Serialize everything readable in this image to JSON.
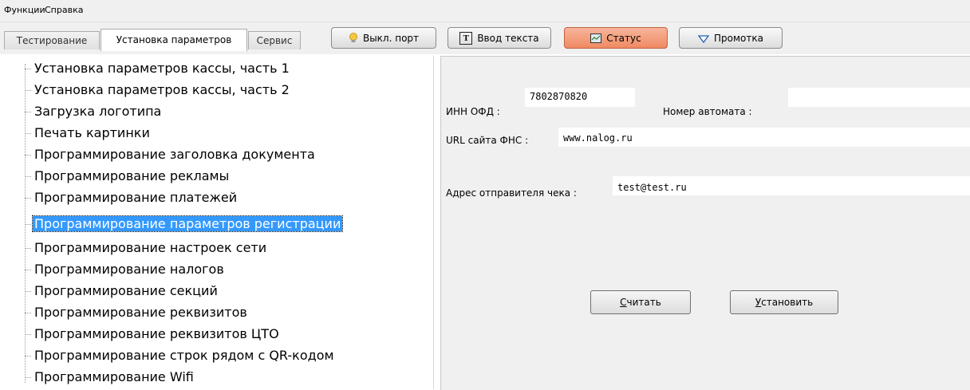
{
  "menubar": {
    "functions": "Функции",
    "help": "Справка"
  },
  "tabs": [
    {
      "label": "Тестирование",
      "active": false
    },
    {
      "label": "Установка параметров",
      "active": true
    },
    {
      "label": "Сервис",
      "active": false
    }
  ],
  "toolbar": {
    "port_button": "Выкл. порт",
    "text_input_button": "Ввод текста",
    "status_button": "Статус",
    "feed_button": "Промотка"
  },
  "tree": {
    "items": [
      "Установка параметров кассы, часть 1",
      "Установка параметров кассы, часть 2",
      "Загрузка логотипа",
      "Печать картинки",
      "Программирование заголовка документа",
      "Программирование рекламы",
      "Программирование платежей",
      "Программирование параметров регистрации",
      "Программирование настроек сети",
      "Программирование налогов",
      "Программирование секций",
      "Программирование реквизитов",
      "Программирование реквизитов ЦТО",
      "Программирование строк рядом с QR-кодом",
      "Программирование Wifi"
    ],
    "selected_index": 7
  },
  "form": {
    "inn_label": "ИНН ОФД :",
    "inn_value": "7802870820",
    "machine_label": "Номер автомата :",
    "machine_value": "",
    "url_label": "URL сайта ФНС :",
    "url_value": "www.nalog.ru",
    "sender_label": "Адрес отправителя чека :",
    "sender_value": "test@test.ru"
  },
  "buttons": {
    "read_first": "С",
    "read_rest": "читать",
    "set_first": "У",
    "set_rest": "становить"
  },
  "colors": {
    "selection": "#3399ff",
    "status_button": "#ef8a62",
    "panel_bg": "#f0f0f0"
  }
}
